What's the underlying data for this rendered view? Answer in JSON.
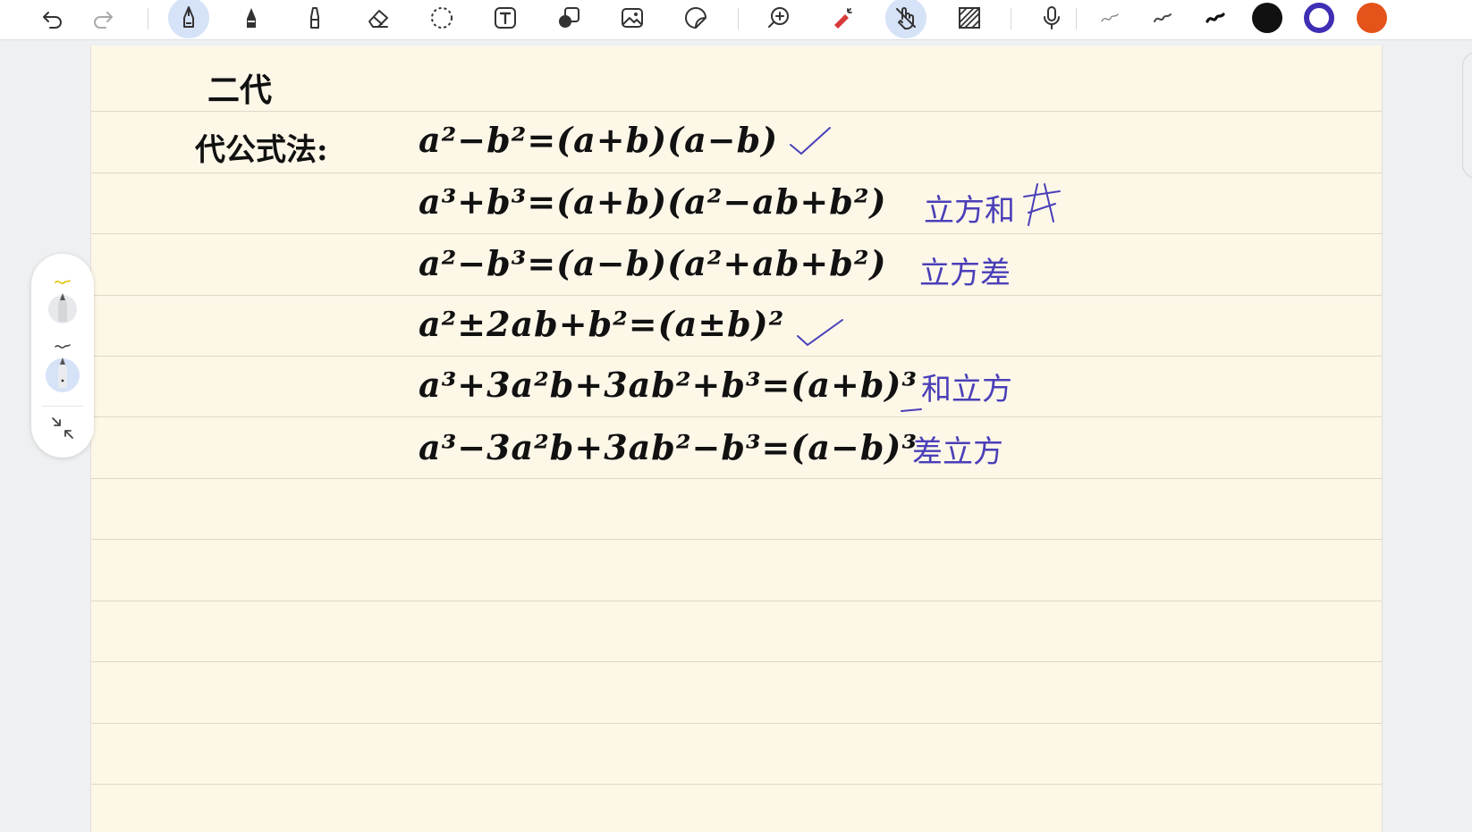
{
  "toolbar": {
    "tools": [
      {
        "name": "undo-icon",
        "interactable": true
      },
      {
        "name": "redo-icon",
        "interactable": true
      },
      {
        "name": "fountain-pen-icon",
        "active": true
      },
      {
        "name": "ballpoint-pen-icon"
      },
      {
        "name": "highlighter-icon"
      },
      {
        "name": "eraser-icon"
      },
      {
        "name": "lasso-select-icon"
      },
      {
        "name": "text-box-icon"
      },
      {
        "name": "shapes-icon"
      },
      {
        "name": "image-icon"
      },
      {
        "name": "sticker-icon"
      },
      {
        "name": "zoom-in-icon"
      },
      {
        "name": "laser-pointer-icon"
      },
      {
        "name": "hand-touch-icon",
        "active": true
      },
      {
        "name": "pattern-fill-icon"
      },
      {
        "name": "microphone-icon"
      },
      {
        "name": "stroke-thin-icon"
      },
      {
        "name": "stroke-medium-icon"
      },
      {
        "name": "stroke-thick-icon"
      }
    ],
    "colors": {
      "black": "#111111",
      "indigo": "#3f2fb4",
      "orange": "#e4531a"
    },
    "selected_color": "indigo"
  },
  "notes": {
    "heading": "二代",
    "section_label": "代公式法:",
    "formulas": [
      "a²−b²=(a+b)(a−b)",
      "a³+b³=(a+b)(a²−ab+b²)",
      "a²−b³=(a−b)(a²+ab+b²)",
      "a²±2ab+b²=(a±b)²",
      "a³+3a²b+3ab²+b³=(a+b)³",
      "a³−3a²b+3ab²−b³=(a−b)³"
    ],
    "annotations": {
      "line2": "立方和",
      "line3": "立方差",
      "line5": "和立方",
      "line6": "差立方"
    }
  }
}
